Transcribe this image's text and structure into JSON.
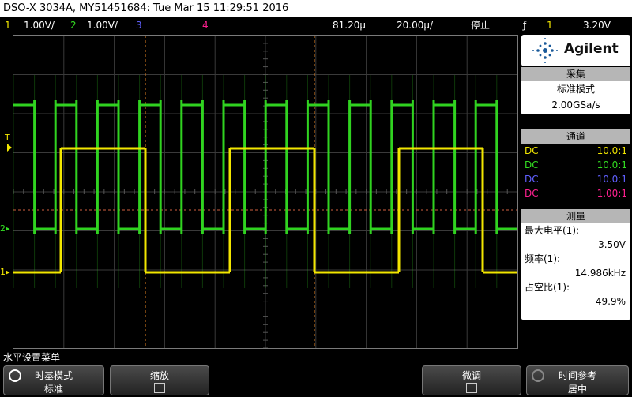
{
  "title": "DSO-X 3034A, MY51451684: Tue Mar 15 11:29:51 2016",
  "status": {
    "ch1_num": "1",
    "ch1_scale": "1.00V/",
    "ch2_num": "2",
    "ch2_scale": "1.00V/",
    "ch3_num": "3",
    "ch4_num": "4",
    "delay": "81.20µ",
    "timebase": "20.00µ/",
    "run_state": "停止",
    "trig_icon": "ƒ",
    "trig_ch": "1",
    "trig_level": "3.20V"
  },
  "logo": "Agilent",
  "acquire": {
    "header": "采集",
    "mode": "标准模式",
    "rate": "2.00GSa/s"
  },
  "channels": {
    "header": "通道",
    "rows": [
      {
        "coupling": "DC",
        "probe": "10.0:1",
        "color": "#f2e600"
      },
      {
        "coupling": "DC",
        "probe": "10.0:1",
        "color": "#33dd22"
      },
      {
        "coupling": "DC",
        "probe": "10.0:1",
        "color": "#6060ff"
      },
      {
        "coupling": "DC",
        "probe": "1.00:1",
        "color": "#ff2090"
      }
    ]
  },
  "measure": {
    "header": "测量",
    "items": [
      {
        "label": "最大电平(1):",
        "value": "3.50V"
      },
      {
        "label": "频率(1):",
        "value": "14.986kHz"
      },
      {
        "label": "占空比(1):",
        "value": "49.9%"
      }
    ]
  },
  "markers": {
    "trigger_level": "T",
    "ch2": "2",
    "ch1": "1"
  },
  "waveforms": {
    "ch1_color": "#f2e600",
    "ch2_color": "#33dd22",
    "ch1_period_us": 66.7,
    "ch1_duty_percent": 49.9,
    "ch2_frequency_ratio": 6
  },
  "bottom": {
    "menu_title": "水平设置菜单",
    "softkeys": [
      {
        "label": "时基模式",
        "value": "标准"
      },
      {
        "label": "缩放",
        "value": ""
      },
      {
        "label": "微调",
        "value": ""
      },
      {
        "label": "时间参考",
        "value": "居中"
      }
    ]
  }
}
